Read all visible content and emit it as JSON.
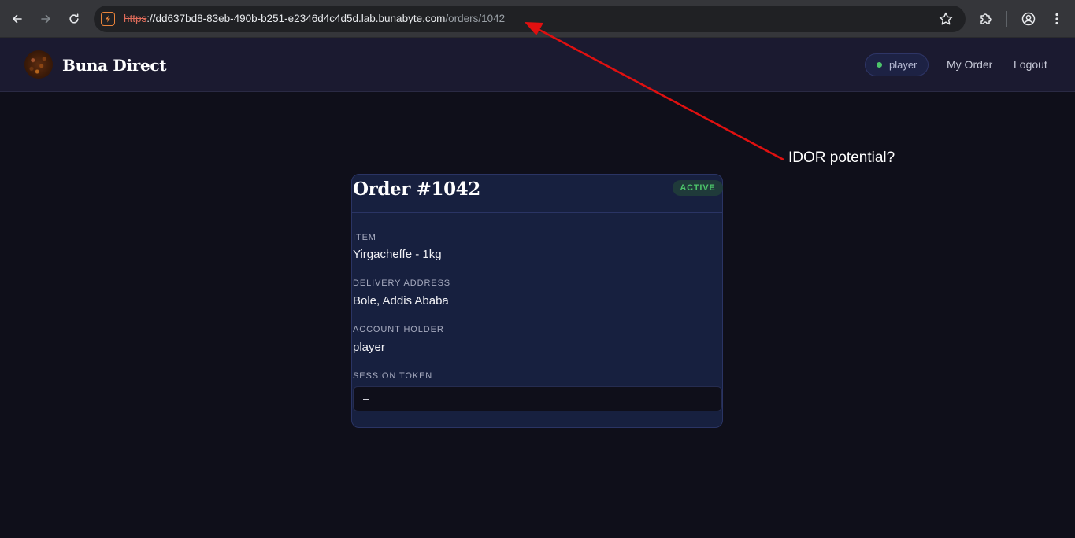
{
  "browser": {
    "url_scheme": "https",
    "url_rest_host": "://dd637bd8-83eb-490b-b251-e2346d4c4d5d.lab.bunabyte.com",
    "url_path": "/orders/1042",
    "icons": [
      "back-icon",
      "forward-icon",
      "reload-icon",
      "site-info-icon",
      "bookmark-star-icon",
      "extensions-icon",
      "profile-icon",
      "menu-icon"
    ]
  },
  "header": {
    "brand": "Buna Direct",
    "user_badge": "player",
    "nav": {
      "my_order": "My Order",
      "logout": "Logout"
    }
  },
  "order": {
    "title": "Order #1042",
    "status": "ACTIVE",
    "fields": {
      "item_label": "ITEM",
      "item_value": "Yirgacheffe - 1kg",
      "address_label": "DELIVERY ADDRESS",
      "address_value": "Bole, Addis Ababa",
      "holder_label": "ACCOUNT HOLDER",
      "holder_value": "player",
      "token_label": "SESSION TOKEN",
      "token_value": "–"
    }
  },
  "annotation": {
    "text": "IDOR potential?",
    "color": "#e01010"
  },
  "colors": {
    "status_green": "#4cc46a",
    "page_bg": "#0f0f1a",
    "card_bg": "#17203f"
  }
}
